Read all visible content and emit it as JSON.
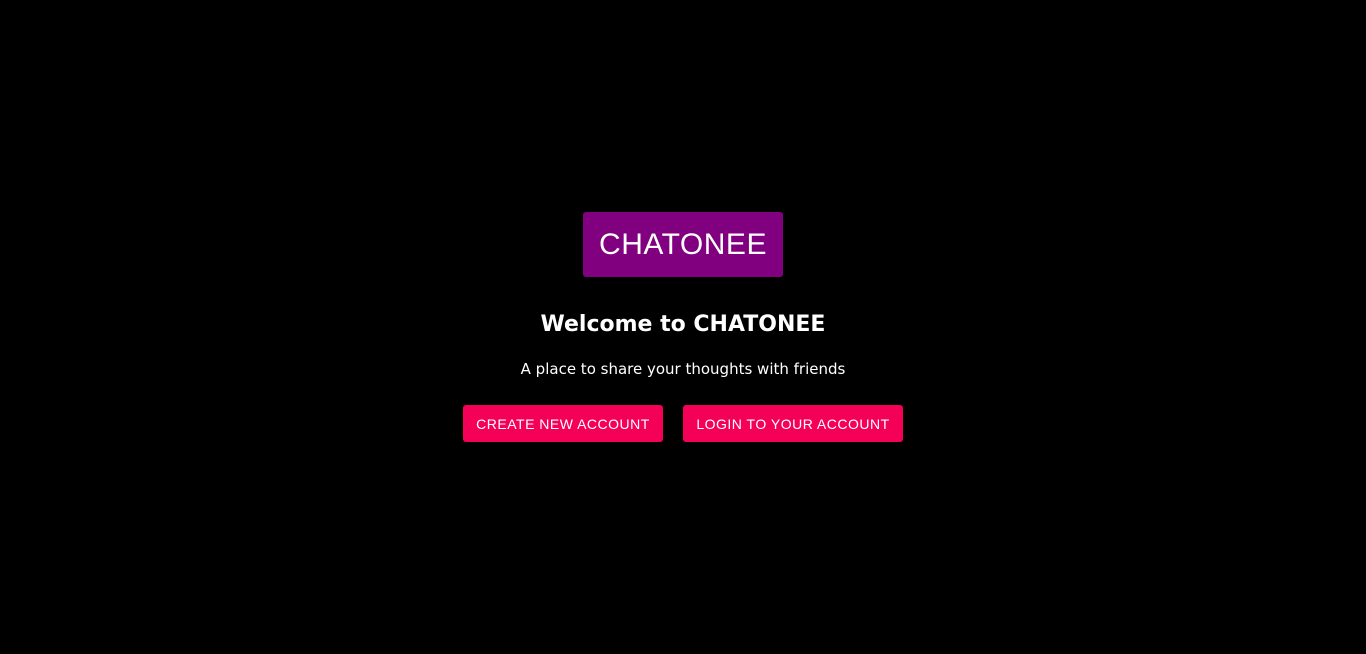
{
  "logo": {
    "text": "CHATONEE"
  },
  "hero": {
    "title": "Welcome to CHATONEE",
    "subtitle": "A place to share your thoughts with friends"
  },
  "actions": {
    "create_label": "CREATE NEW ACCOUNT",
    "login_label": "LOGIN TO YOUR ACCOUNT"
  },
  "colors": {
    "background": "#000000",
    "logo_background": "#800080",
    "button_background": "#f50057",
    "text": "#ffffff"
  }
}
